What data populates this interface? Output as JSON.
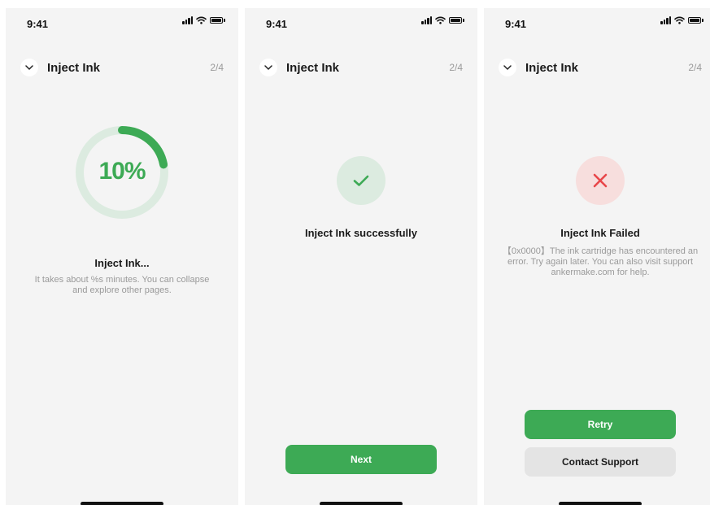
{
  "status_bar": {
    "time": "9:41"
  },
  "header": {
    "title": "Inject Ink",
    "step": "2/4"
  },
  "screens": {
    "progress": {
      "percent_label": "10%",
      "progress_fraction": 0.1,
      "title": "Inject Ink...",
      "description": "It takes about %s minutes. You can collapse and explore other pages."
    },
    "success": {
      "title": "Inject Ink successfully",
      "next_label": "Next"
    },
    "failed": {
      "title": "Inject Ink Failed",
      "description": "【0x0000】The ink cartridge has encountered an error. Try again later. You can also visit support ankermake.com for help.",
      "retry_label": "Retry",
      "contact_label": "Contact Support"
    }
  },
  "icons": {
    "collapse": "chevron-down-icon",
    "signal": "cellular-signal-icon",
    "wifi": "wifi-icon",
    "battery": "battery-icon",
    "success": "checkmark-icon",
    "failure": "cross-icon"
  },
  "colors": {
    "accent": "#3daa55",
    "success_bg": "#dcebe0",
    "error": "#e8474a",
    "error_bg": "#f7dedd",
    "screen_bg": "#f4f4f4"
  }
}
